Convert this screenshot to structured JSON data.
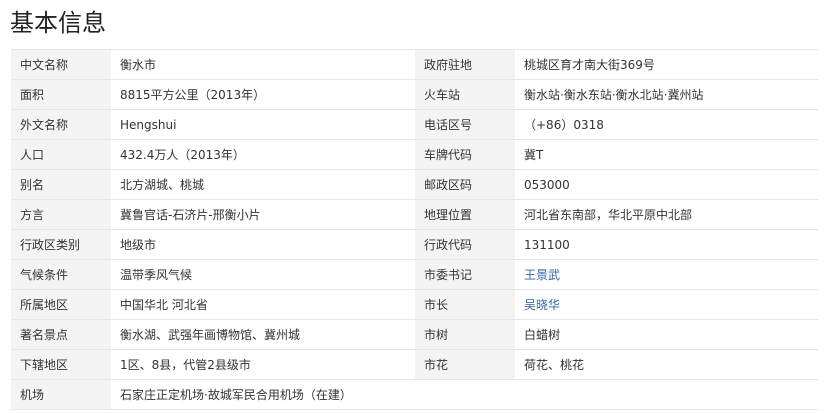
{
  "page": {
    "title": "基本信息"
  },
  "info": {
    "rows": [
      {
        "k1": "中文名称",
        "v1": "衡水市",
        "k2": "政府驻地",
        "v2": "桃城区育才南大街369号"
      },
      {
        "k1": "面积",
        "v1": "8815平方公里（2013年）",
        "k2": "火车站",
        "v2": "衡水站·衡水东站·衡水北站·冀州站"
      },
      {
        "k1": "外文名称",
        "v1": "Hengshui",
        "k2": "电话区号",
        "v2": "（+86）0318"
      },
      {
        "k1": "人口",
        "v1": "432.4万人（2013年）",
        "k2": "车牌代码",
        "v2": "冀T"
      },
      {
        "k1": "别名",
        "v1": "北方湖城、桃城",
        "k2": "邮政区码",
        "v2": "053000"
      },
      {
        "k1": "方言",
        "v1": "冀鲁官话-石济片-邢衡小片",
        "k2": "地理位置",
        "v2": "河北省东南部，华北平原中北部"
      },
      {
        "k1": "行政区类别",
        "v1": "地级市",
        "k2": "行政代码",
        "v2": "131100"
      },
      {
        "k1": "气候条件",
        "v1": "温带季风气候",
        "k2": "市委书记",
        "v2": "王景武"
      },
      {
        "k1": "所属地区",
        "v1": "中国华北 河北省",
        "k2": "市长",
        "v2": "吴晓华"
      },
      {
        "k1": "著名景点",
        "v1": "衡水湖、武强年画博物馆、冀州城",
        "k2": "市树",
        "v2": "白蜡树"
      },
      {
        "k1": "下辖地区",
        "v1": "1区、8县，代管2县级市",
        "k2": "市花",
        "v2": "荷花、桃花"
      },
      {
        "k1": "机场",
        "v1": "石家庄正定机场·故城军民合用机场（在建）"
      }
    ]
  }
}
